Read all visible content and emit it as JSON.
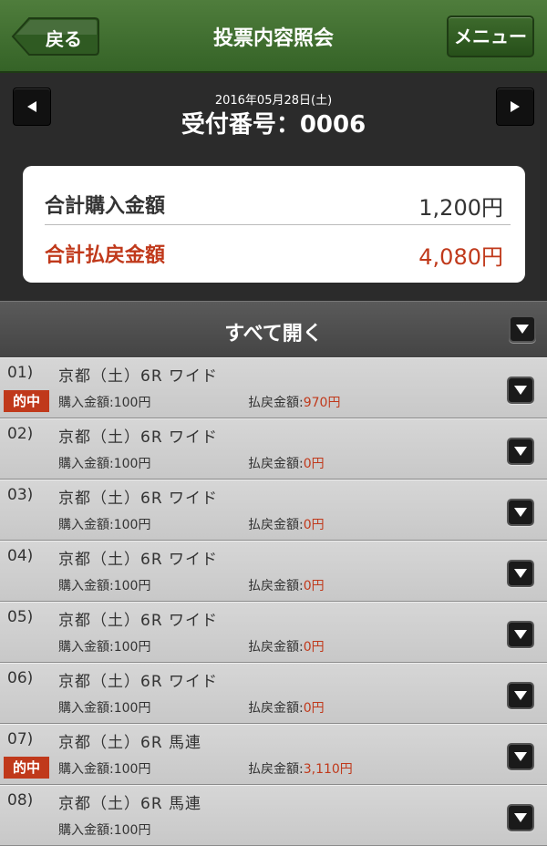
{
  "header": {
    "back_label": "戻る",
    "title": "投票内容照会",
    "menu_label": "メニュー"
  },
  "receipt": {
    "date": "2016年05月28日(土)",
    "number": "受付番号：0006"
  },
  "summary": {
    "purchase_label": "合計購入金額",
    "purchase_value": "1,200円",
    "payout_label": "合計払戻金額",
    "payout_value": "4,080円"
  },
  "open_all_label": "すべて開く",
  "hit_badge": "的中",
  "buy_prefix": "購入金額:",
  "pay_prefix": "払戻金額:",
  "colors": {
    "header_green": "#3f6d2f",
    "accent_red": "#c0391b"
  },
  "bets": [
    {
      "num": "01)",
      "race": "京都（土）6R ワイド",
      "hit": true,
      "buy": "100円",
      "pay": "970円"
    },
    {
      "num": "02)",
      "race": "京都（土）6R ワイド",
      "hit": false,
      "buy": "100円",
      "pay": "0円"
    },
    {
      "num": "03)",
      "race": "京都（土）6R ワイド",
      "hit": false,
      "buy": "100円",
      "pay": "0円"
    },
    {
      "num": "04)",
      "race": "京都（土）6R ワイド",
      "hit": false,
      "buy": "100円",
      "pay": "0円"
    },
    {
      "num": "05)",
      "race": "京都（土）6R ワイド",
      "hit": false,
      "buy": "100円",
      "pay": "0円"
    },
    {
      "num": "06)",
      "race": "京都（土）6R ワイド",
      "hit": false,
      "buy": "100円",
      "pay": "0円"
    },
    {
      "num": "07)",
      "race": "京都（土）6R 馬連",
      "hit": true,
      "buy": "100円",
      "pay": "3,110円"
    },
    {
      "num": "08)",
      "race": "京都（土）6R 馬連",
      "hit": false,
      "buy": "100円",
      "pay": ""
    }
  ]
}
